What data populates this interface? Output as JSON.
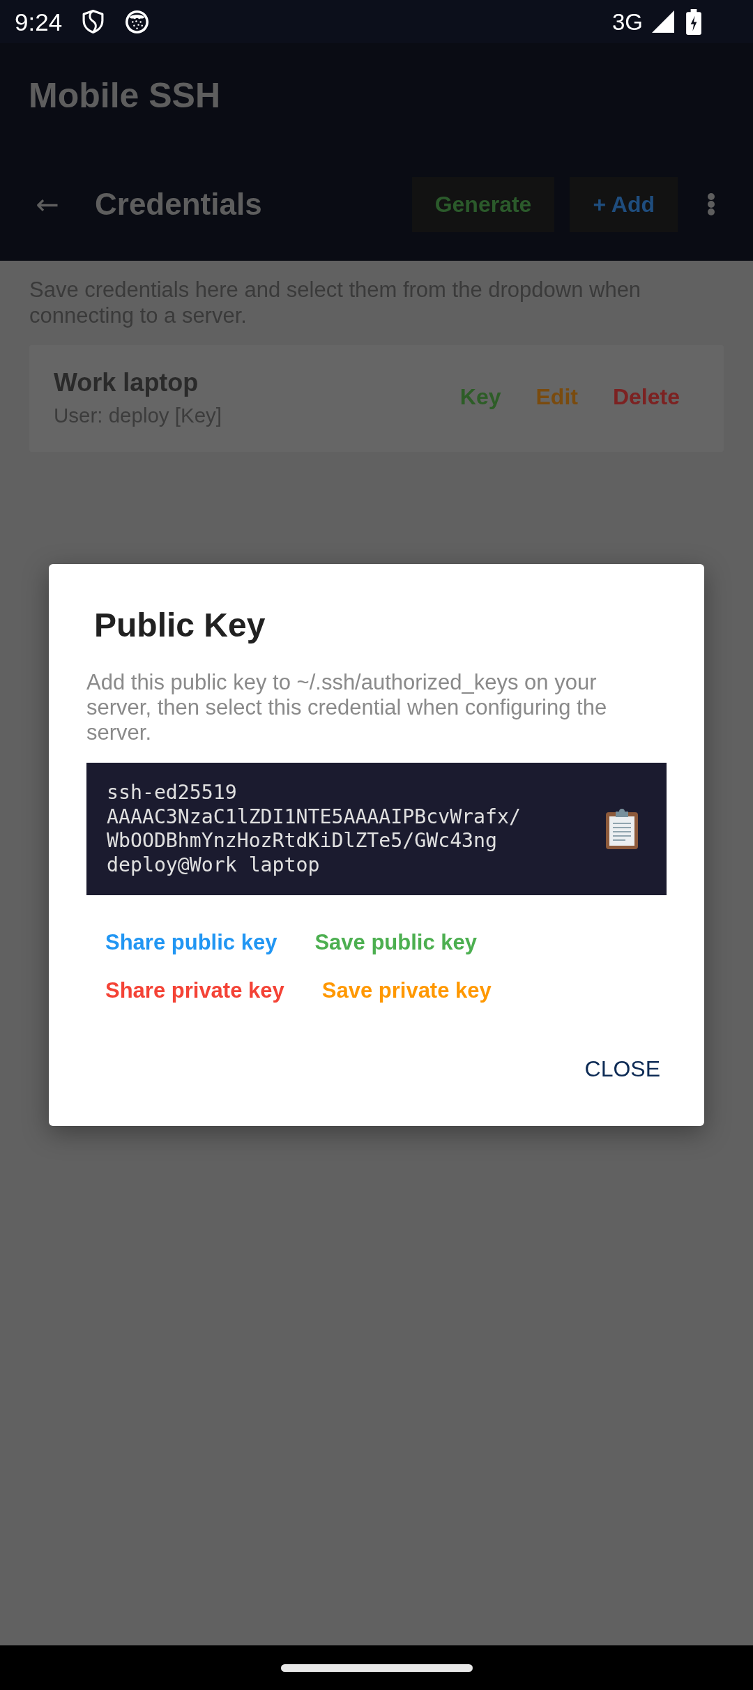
{
  "status_bar": {
    "time": "9:24",
    "network": "3G"
  },
  "app": {
    "title": "Mobile SSH"
  },
  "header": {
    "back": "←",
    "title": "Credentials",
    "actions": [
      {
        "label": "Generate",
        "color": "#2b5a2b"
      },
      {
        "label": "+ Add",
        "color": "#1f4d7e"
      }
    ]
  },
  "intro": "Save credentials here and select them from the dropdown when connecting to a server.",
  "credentials": [
    {
      "name": "Work laptop",
      "detail": "User: deploy [Key]",
      "actions": [
        {
          "label": "Key",
          "color": "#2d5d27"
        },
        {
          "label": "Edit",
          "color": "#7a4b0e"
        },
        {
          "label": "Delete",
          "color": "#7c2222"
        }
      ]
    }
  ],
  "dialog": {
    "title": "Public Key",
    "message": "Add this public key to ~/.ssh/authorized_keys on your server, then select this credential when configuring the server.",
    "public_key": "ssh-ed25519 AAAAC3NzaC1lZDI1NTE5AAAAIPBcvWrafx/WbOODBhmYnzHozRtdKiDlZTe5/GWc43ng deploy@Work laptop",
    "actions": [
      {
        "label": "Share public key",
        "color": "#2196f3"
      },
      {
        "label": "Save public key",
        "color": "#4caf50"
      },
      {
        "label": "Share private key",
        "color": "#f44336"
      },
      {
        "label": "Save private key",
        "color": "#ff9800"
      }
    ],
    "close": "CLOSE"
  }
}
